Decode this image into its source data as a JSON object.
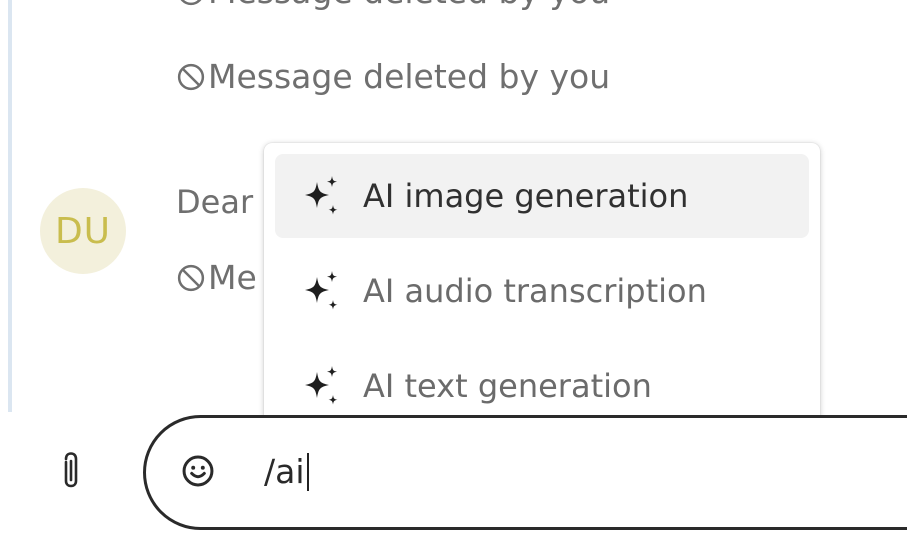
{
  "messages": {
    "cut_text": "Message deleted by you",
    "deleted_1": "Message deleted by you",
    "sender_partial": "Dear",
    "deleted_2_partial": "Me"
  },
  "avatar": {
    "initials": "DU",
    "bg": "#f3f0dc",
    "fg": "#c9bd4e"
  },
  "command_menu": {
    "items": [
      {
        "label": "AI image generation",
        "icon": "sparkles-icon",
        "highlighted": true
      },
      {
        "label": "AI audio transcription",
        "icon": "sparkles-icon",
        "highlighted": false
      },
      {
        "label": "AI text generation",
        "icon": "sparkles-icon",
        "highlighted": false
      }
    ]
  },
  "composer": {
    "value": "/ai",
    "attach_icon": "paperclip-icon",
    "emoji_icon": "smiley-icon"
  }
}
